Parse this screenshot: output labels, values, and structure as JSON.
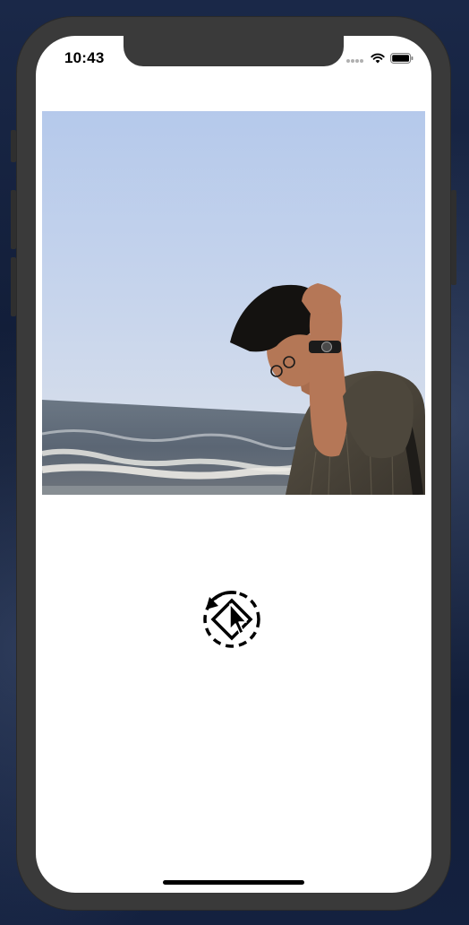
{
  "status_bar": {
    "time": "10:43",
    "icons": [
      "signal-dots-icon",
      "wifi-icon",
      "battery-icon"
    ]
  },
  "main": {
    "image_alt": "",
    "loader_icon": "rotate-left-icon",
    "cursor_icon": "pointer-cursor-icon"
  },
  "colors": {
    "screen_bg": "#ffffff",
    "frame": "#3a3a3a",
    "sky_top": "#b8cbea",
    "sea": "#5b6876"
  }
}
